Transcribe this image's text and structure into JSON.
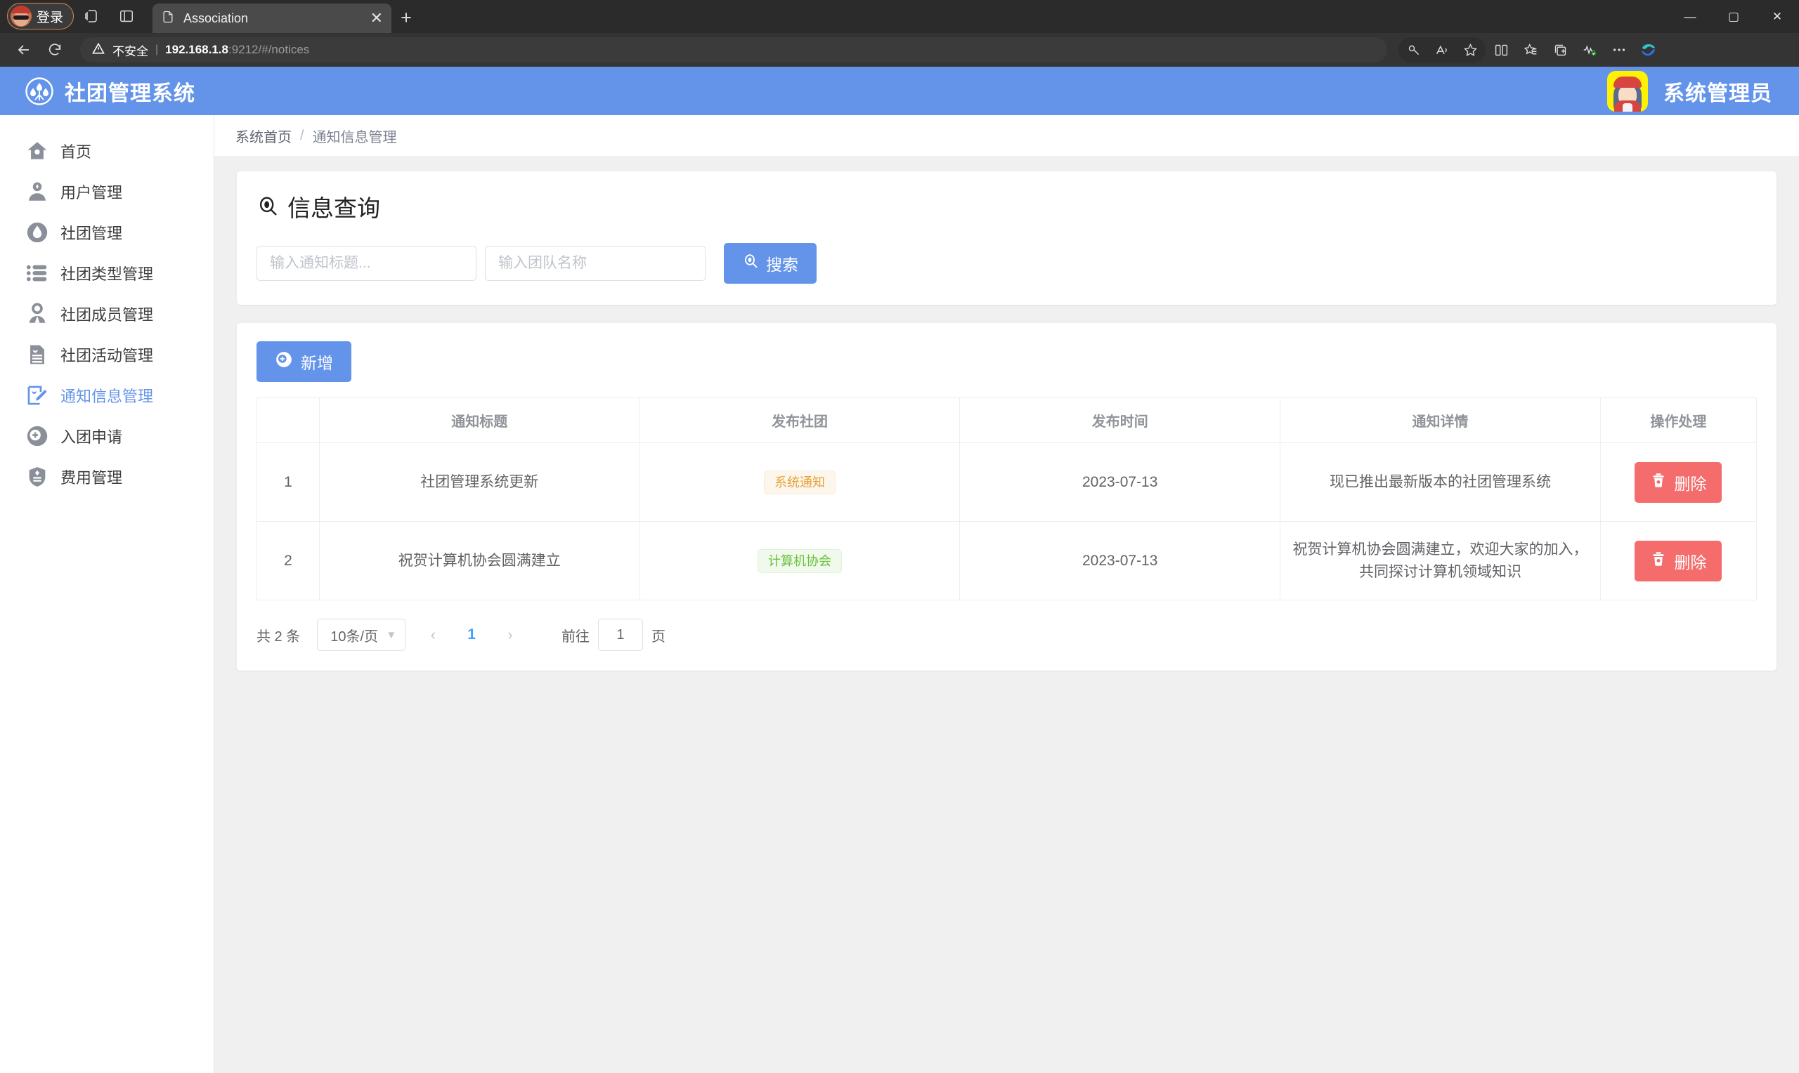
{
  "browser": {
    "profile_label": "登录",
    "tab_title": "Association",
    "new_tab": "+",
    "close_tab": "✕",
    "security_label": "不安全",
    "url_host": "192.168.1.8",
    "url_rest": ":9212/#/notices",
    "minimize": "—",
    "maximize": "▢",
    "close": "✕",
    "icons": {
      "workspaces": "workspaces-icon",
      "split_panel": "split-panel-icon",
      "tab_file": "file-icon",
      "back": "back-arrow-icon",
      "reload": "reload-icon",
      "warning": "warning-triangle-icon",
      "key": "key-icon",
      "read_aloud": "read-aloud-icon",
      "favorite": "star-icon",
      "split_screen": "split-screen-icon",
      "collections": "collections-icon",
      "add_tabs": "add-tabs-icon",
      "performance": "performance-icon",
      "settings_more": "more-options-icon",
      "copilot": "copilot-icon"
    }
  },
  "app": {
    "brand_title": "社团管理系统",
    "admin_name": "系统管理员"
  },
  "sidebar": {
    "items": [
      {
        "label": "首页",
        "icon": "home-icon",
        "active": false
      },
      {
        "label": "用户管理",
        "icon": "user-icon",
        "active": false
      },
      {
        "label": "社团管理",
        "icon": "drop-icon",
        "active": false
      },
      {
        "label": "社团类型管理",
        "icon": "list-icon",
        "active": false
      },
      {
        "label": "社团成员管理",
        "icon": "member-icon",
        "active": false
      },
      {
        "label": "社团活动管理",
        "icon": "document-icon",
        "active": false
      },
      {
        "label": "通知信息管理",
        "icon": "edit-note-icon",
        "active": true
      },
      {
        "label": "入团申请",
        "icon": "plus-circle-icon",
        "active": false
      },
      {
        "label": "费用管理",
        "icon": "shield-icon",
        "active": false
      }
    ]
  },
  "breadcrumb": {
    "home": "系统首页",
    "separator": "/",
    "current": "通知信息管理"
  },
  "query_panel": {
    "title": "信息查询",
    "title_icon": "search-icon",
    "notice_title_placeholder": "输入通知标题...",
    "notice_title_value": "",
    "team_name_placeholder": "输入团队名称",
    "team_name_value": "",
    "search_button": "搜索",
    "search_button_icon": "search-icon"
  },
  "table_panel": {
    "add_button": "新增",
    "add_button_icon": "plus-circle-icon",
    "columns": [
      "",
      "通知标题",
      "发布社团",
      "发布时间",
      "通知详情",
      "操作处理"
    ],
    "rows": [
      {
        "index": "1",
        "title": "社团管理系统更新",
        "org": "系统通知",
        "org_style": "warn",
        "time": "2023-07-13",
        "detail": "现已推出最新版本的社团管理系统",
        "action": "删除",
        "action_icon": "trash-icon"
      },
      {
        "index": "2",
        "title": "祝贺计算机协会圆满建立",
        "org": "计算机协会",
        "org_style": "ok",
        "time": "2023-07-13",
        "detail": "祝贺计算机协会圆满建立，欢迎大家的加入，共同探讨计算机领域知识",
        "action": "删除",
        "action_icon": "trash-icon"
      }
    ]
  },
  "pagination": {
    "total_text": "共 2 条",
    "page_size": "10条/页",
    "prev": "‹",
    "next": "›",
    "current_page": "1",
    "jump_prefix": "前往",
    "jump_value": "1",
    "jump_suffix": "页"
  },
  "colors": {
    "brand_blue": "#6394ea",
    "danger_red": "#f56c6c",
    "tag_warn": "#e6a23c",
    "tag_ok": "#67c23a",
    "link_blue": "#409eff"
  }
}
